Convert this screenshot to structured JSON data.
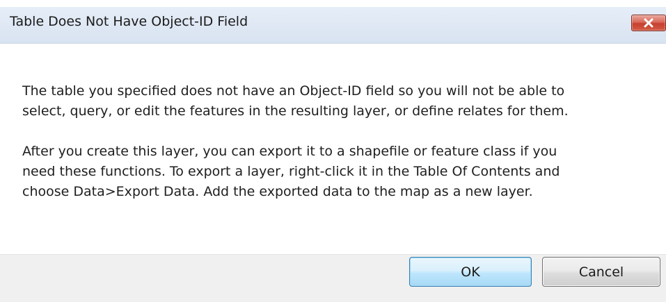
{
  "window": {
    "title": "Table Does Not Have Object-ID Field",
    "close_icon": "close-x-icon",
    "close_color": "#c6402f"
  },
  "message": {
    "paragraph1_line1": "The table you specified does not have an Object-ID field so you will not be able to",
    "paragraph1_line2": "select, query, or edit the features in the resulting layer, or define relates for them.",
    "paragraph2_line1": "After you create this layer, you can export it to a shapefile or feature class if you",
    "paragraph2_line2": "need these functions. To export a layer, right-click it in the Table Of Contents and",
    "paragraph2_line3": "choose Data>Export Data. Add the exported data to the map as a new layer."
  },
  "buttons": {
    "ok_label": "OK",
    "cancel_label": "Cancel"
  }
}
